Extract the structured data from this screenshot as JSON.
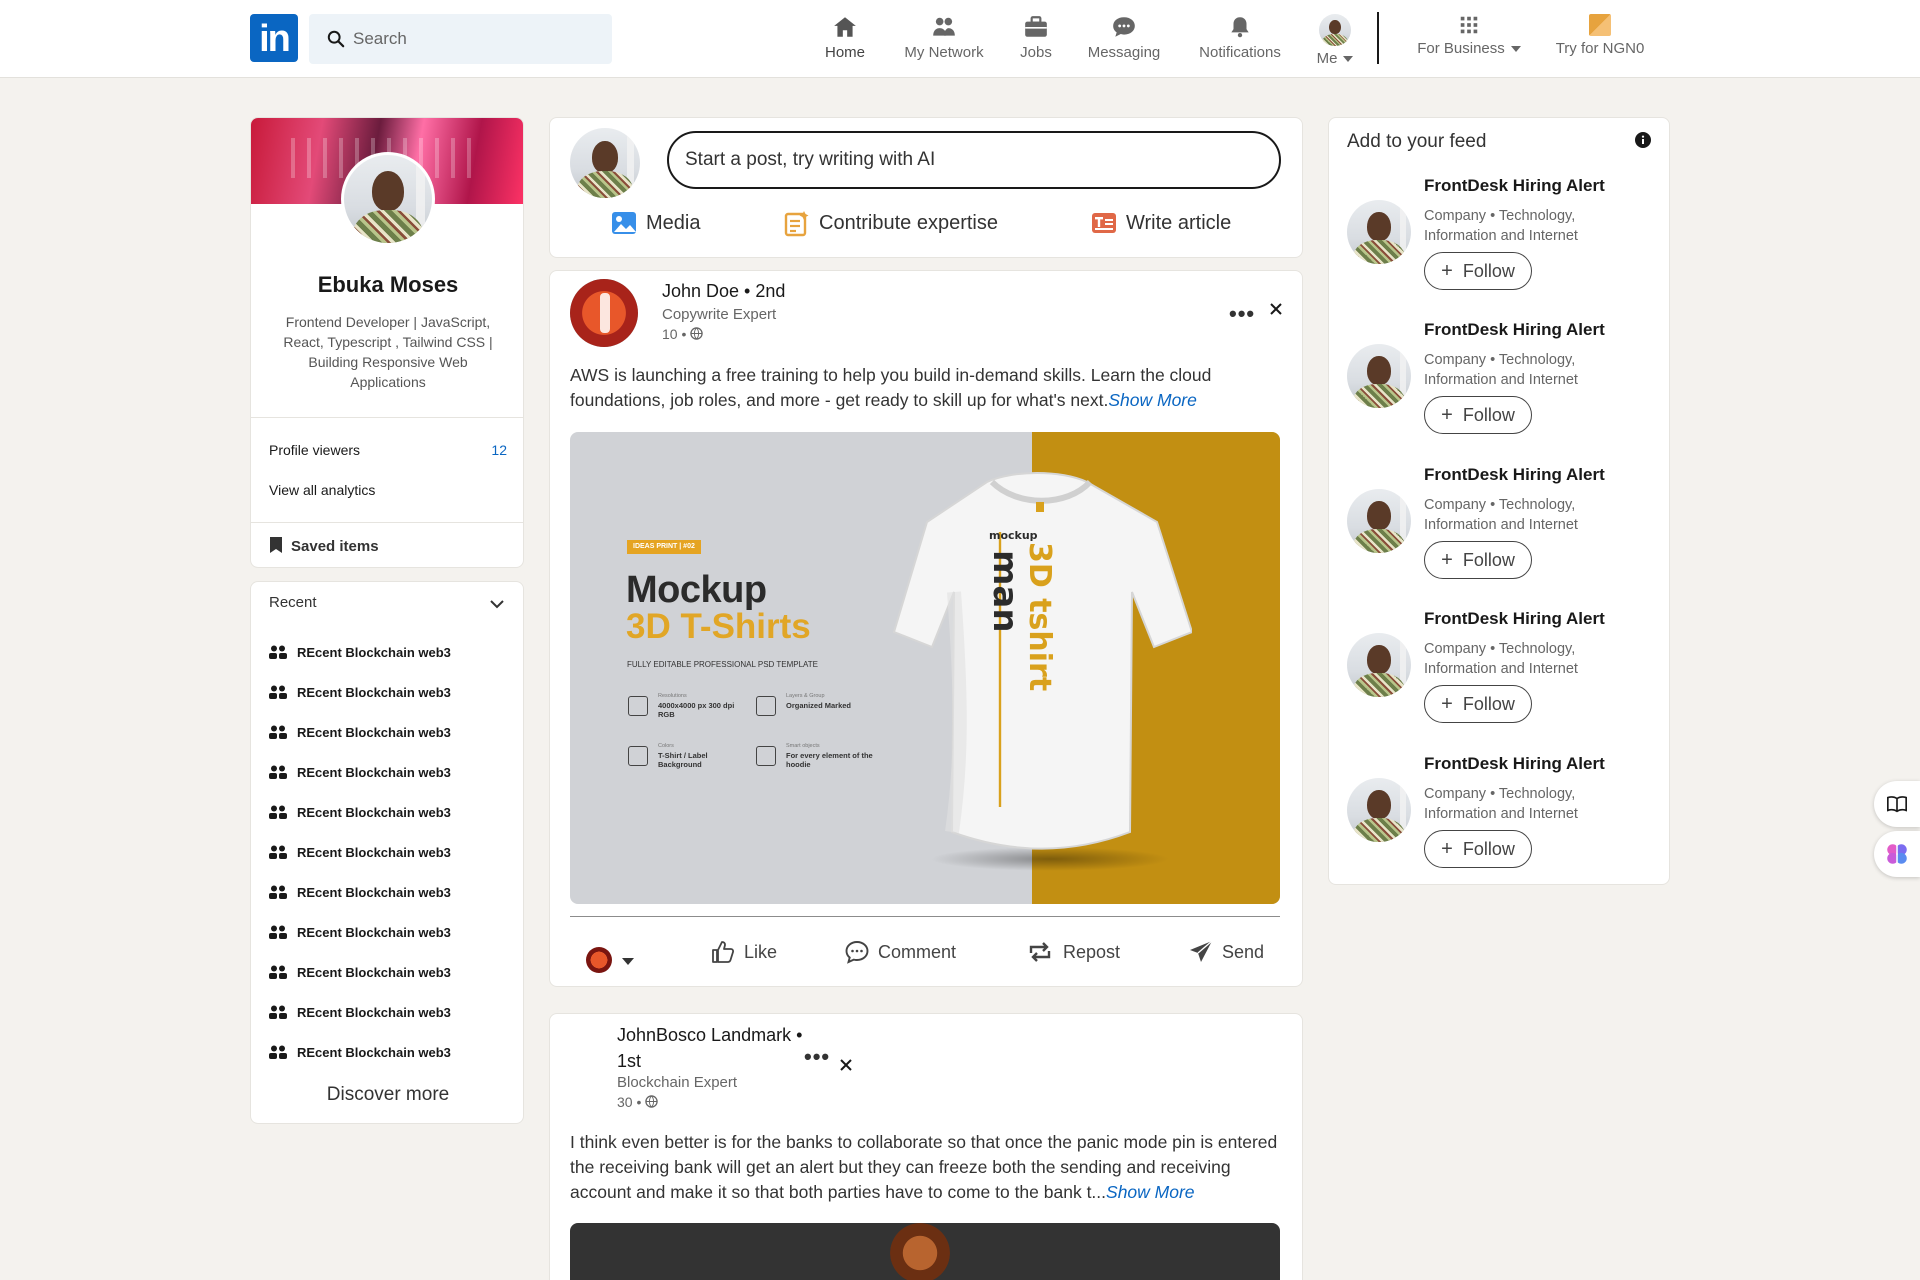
{
  "nav": {
    "logo": "in",
    "search_placeholder": "Search",
    "items": [
      {
        "label": "Home",
        "icon": "home-icon"
      },
      {
        "label": "My Network",
        "icon": "network-icon"
      },
      {
        "label": "Jobs",
        "icon": "briefcase-icon"
      },
      {
        "label": "Messaging",
        "icon": "message-icon"
      },
      {
        "label": "Notifications",
        "icon": "bell-icon"
      },
      {
        "label": "Me",
        "icon": "avatar"
      }
    ],
    "business_label": "For Business",
    "try_label": "Try for NGN0"
  },
  "profile": {
    "name": "Ebuka Moses",
    "headline": "Frontend Developer | JavaScript, React, Typescript , Tailwind CSS | Building Responsive Web Applications",
    "viewers_label": "Profile viewers",
    "viewers_count": "12",
    "analytics_label": "View all analytics",
    "saved_label": "Saved items"
  },
  "recent": {
    "title": "Recent",
    "items": [
      "REcent Blockchain web3",
      "REcent Blockchain web3",
      "REcent Blockchain web3",
      "REcent Blockchain web3",
      "REcent Blockchain web3",
      "REcent Blockchain web3",
      "REcent Blockchain web3",
      "REcent Blockchain web3",
      "REcent Blockchain web3",
      "REcent Blockchain web3",
      "REcent Blockchain web3"
    ],
    "discover_label": "Discover more"
  },
  "composer": {
    "placeholder": "Start a post, try writing with AI",
    "media_label": "Media",
    "contribute_label": "Contribute expertise",
    "article_label": "Write article"
  },
  "post1": {
    "author": "John Doe • 2nd",
    "subtitle": "Copywrite Expert",
    "time": "10 •",
    "text": "AWS is launching a free training to help you build in-demand skills. Learn the cloud foundations, job roles, and more - get ready to skill up for what's next.",
    "show_more": "Show More",
    "image": {
      "badge": "IDEAS PRINT | #02",
      "title1": "Mockup",
      "title2": "3D T-Shirts",
      "subtitle": "FULLY EDITABLE PROFESSIONAL PSD TEMPLATE",
      "features": [
        {
          "small": "Resolutions",
          "text": "4000x4000 px 300 dpi RGB"
        },
        {
          "small": "Layers & Group",
          "text": "Organized Marked"
        },
        {
          "small": "Colors",
          "text": "T-Shirt / Label Background"
        },
        {
          "small": "Smart objects",
          "text": "For every element of the hoodie"
        }
      ],
      "shirt_print": "mockup man 3D tshirt"
    },
    "actions": {
      "like": "Like",
      "comment": "Comment",
      "repost": "Repost",
      "send": "Send"
    }
  },
  "post2": {
    "author": "JohnBosco Landmark • 1st",
    "subtitle": "Blockchain Expert",
    "time": "30 •",
    "text": "I think even better is for the banks to collaborate so that once the panic mode pin is entered the receiving bank will get an alert but they can freeze both the sending and receiving account and make it so that both parties have to come to the bank t...",
    "show_more": "Show More"
  },
  "feed": {
    "title": "Add to your feed",
    "items": [
      {
        "name": "FrontDesk Hiring Alert",
        "desc": "Company • Technology, Information and Internet",
        "follow": "Follow"
      },
      {
        "name": "FrontDesk Hiring Alert",
        "desc": "Company • Technology, Information and Internet",
        "follow": "Follow"
      },
      {
        "name": "FrontDesk Hiring Alert",
        "desc": "Company • Technology, Information and Internet",
        "follow": "Follow"
      },
      {
        "name": "FrontDesk Hiring Alert",
        "desc": "Company • Technology, Information and Internet",
        "follow": "Follow"
      },
      {
        "name": "FrontDesk Hiring Alert",
        "desc": "Company • Technology, Information and Internet",
        "follow": "Follow"
      }
    ]
  },
  "colors": {
    "brand": "#0a66c2",
    "page_bg": "#f4f2ee",
    "mockup_gold": "#c28f12"
  }
}
